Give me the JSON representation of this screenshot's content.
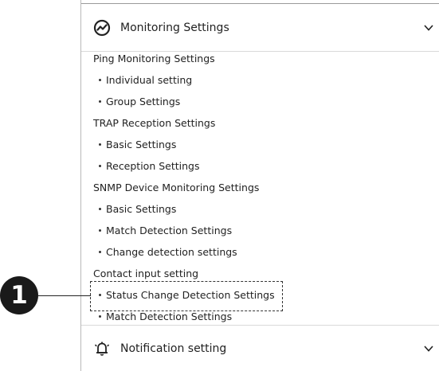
{
  "callout": {
    "number": "1"
  },
  "sections": {
    "monitoring": {
      "label": "Monitoring Settings",
      "icon": "monitoring-chart-icon",
      "expanded": true,
      "items": [
        {
          "label": "Ping Monitoring Settings",
          "level": 0
        },
        {
          "label": "Individual setting",
          "level": 1
        },
        {
          "label": "Group Settings",
          "level": 1
        },
        {
          "label": "TRAP Reception Settings",
          "level": 0
        },
        {
          "label": "Basic Settings",
          "level": 1
        },
        {
          "label": "Reception Settings",
          "level": 1
        },
        {
          "label": "SNMP Device Monitoring Settings",
          "level": 0
        },
        {
          "label": "Basic Settings",
          "level": 1
        },
        {
          "label": "Match Detection Settings",
          "level": 1
        },
        {
          "label": "Change detection settings",
          "level": 1
        },
        {
          "label": "Contact input setting",
          "level": 0
        },
        {
          "label": "Status Change Detection Settings",
          "level": 1,
          "highlighted": true
        },
        {
          "label": "Match Detection Settings",
          "level": 1
        }
      ]
    },
    "notification": {
      "label": "Notification setting",
      "icon": "bell-icon",
      "expanded": false
    }
  },
  "colors": {
    "text": "#222222",
    "divider": "#d9d9d9",
    "callout": "#1a1a1a"
  }
}
